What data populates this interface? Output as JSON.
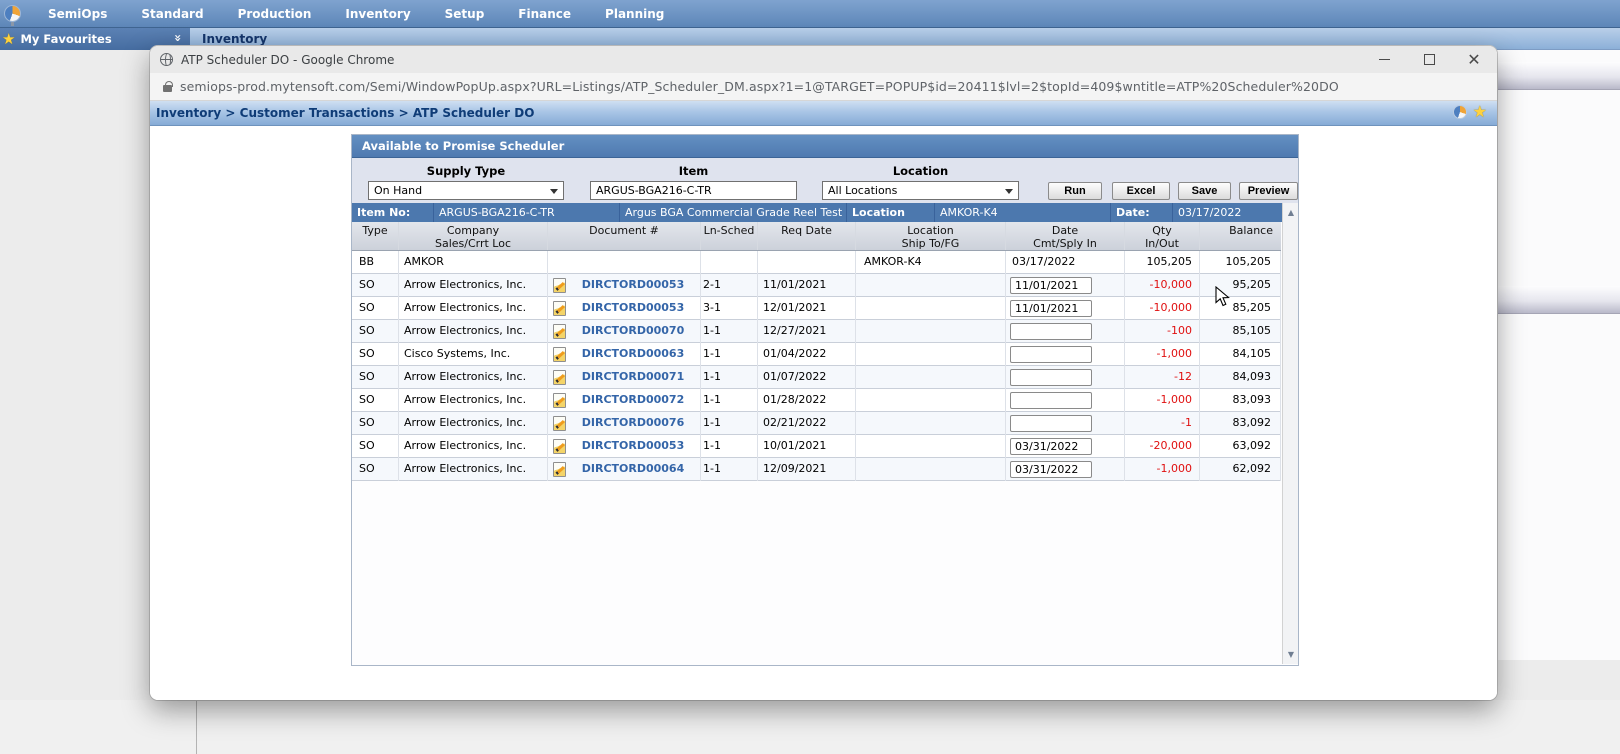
{
  "app": {
    "menu": [
      "SemiOps",
      "Standard",
      "Production",
      "Inventory",
      "Setup",
      "Finance",
      "Planning"
    ],
    "favourites_label": "My Favourites",
    "active_tab": "Inventory"
  },
  "window": {
    "title": "ATP Scheduler DO - Google Chrome",
    "url": "semiops-prod.mytensoft.com/Semi/WindowPopUp.aspx?URL=Listings/ATP_Scheduler_DM.aspx?1=1@TARGET=POPUP$id=20411$lvl=2$topId=409$wntitle=ATP%20Scheduler%20DO",
    "breadcrumb": "Inventory > Customer Transactions > ATP Scheduler DO"
  },
  "scheduler": {
    "panel_title": "Available to Promise Scheduler",
    "filters": {
      "supply_type_label": "Supply Type",
      "supply_type_value": "On Hand",
      "item_label": "Item",
      "item_value": "ARGUS-BGA216-C-TR",
      "location_label": "Location",
      "location_value": "All Locations"
    },
    "buttons": {
      "run": "Run",
      "excel": "Excel",
      "save": "Save",
      "preview": "Preview"
    },
    "info_bar": {
      "item_no_label": "Item No:",
      "item_no": "ARGUS-BGA216-C-TR",
      "item_desc": "Argus BGA Commercial Grade Reel Test",
      "location_label": "Location",
      "location_value": "AMKOR-K4",
      "date_label": "Date:",
      "date_value": "03/17/2022"
    },
    "columns": [
      {
        "line1": "Type",
        "line2": ""
      },
      {
        "line1": "Company",
        "line2": "Sales/Crrt Loc"
      },
      {
        "line1": "Document #",
        "line2": ""
      },
      {
        "line1": "Ln-Sched",
        "line2": ""
      },
      {
        "line1": "Req Date",
        "line2": ""
      },
      {
        "line1": "Location",
        "line2": "Ship To/FG"
      },
      {
        "line1": "Date",
        "line2": "Cmt/Sply In"
      },
      {
        "line1": "Qty",
        "line2": "In/Out"
      },
      {
        "line1": "Balance",
        "line2": ""
      }
    ],
    "rows": [
      {
        "type": "BB",
        "company": "AMKOR",
        "doc": "",
        "ln_sched": "",
        "req_date": "",
        "location": "AMKOR-K4",
        "date_text": "03/17/2022",
        "date_input": null,
        "qty": "105,205",
        "balance": "105,205"
      },
      {
        "type": "SO",
        "company": "Arrow Electronics, Inc.",
        "doc": "DIRCTORD00053",
        "ln_sched": "2-1",
        "req_date": "11/01/2021",
        "location": "",
        "date_text": "",
        "date_input": "11/01/2021",
        "qty": "-10,000",
        "balance": "95,205"
      },
      {
        "type": "SO",
        "company": "Arrow Electronics, Inc.",
        "doc": "DIRCTORD00053",
        "ln_sched": "3-1",
        "req_date": "12/01/2021",
        "location": "",
        "date_text": "",
        "date_input": "11/01/2021",
        "qty": "-10,000",
        "balance": "85,205"
      },
      {
        "type": "SO",
        "company": "Arrow Electronics, Inc.",
        "doc": "DIRCTORD00070",
        "ln_sched": "1-1",
        "req_date": "12/27/2021",
        "location": "",
        "date_text": "",
        "date_input": "",
        "qty": "-100",
        "balance": "85,105"
      },
      {
        "type": "SO",
        "company": "Cisco Systems, Inc.",
        "doc": "DIRCTORD00063",
        "ln_sched": "1-1",
        "req_date": "01/04/2022",
        "location": "",
        "date_text": "",
        "date_input": "",
        "qty": "-1,000",
        "balance": "84,105"
      },
      {
        "type": "SO",
        "company": "Arrow Electronics, Inc.",
        "doc": "DIRCTORD00071",
        "ln_sched": "1-1",
        "req_date": "01/07/2022",
        "location": "",
        "date_text": "",
        "date_input": "",
        "qty": "-12",
        "balance": "84,093"
      },
      {
        "type": "SO",
        "company": "Arrow Electronics, Inc.",
        "doc": "DIRCTORD00072",
        "ln_sched": "1-1",
        "req_date": "01/28/2022",
        "location": "",
        "date_text": "",
        "date_input": "",
        "qty": "-1,000",
        "balance": "83,093"
      },
      {
        "type": "SO",
        "company": "Arrow Electronics, Inc.",
        "doc": "DIRCTORD00076",
        "ln_sched": "1-1",
        "req_date": "02/21/2022",
        "location": "",
        "date_text": "",
        "date_input": "",
        "qty": "-1",
        "balance": "83,092"
      },
      {
        "type": "SO",
        "company": "Arrow Electronics, Inc.",
        "doc": "DIRCTORD00053",
        "ln_sched": "1-1",
        "req_date": "10/01/2021",
        "location": "",
        "date_text": "",
        "date_input": "03/31/2022",
        "qty": "-20,000",
        "balance": "63,092"
      },
      {
        "type": "SO",
        "company": "Arrow Electronics, Inc.",
        "doc": "DIRCTORD00064",
        "ln_sched": "1-1",
        "req_date": "12/09/2021",
        "location": "",
        "date_text": "",
        "date_input": "03/31/2022",
        "qty": "-1,000",
        "balance": "62,092"
      }
    ]
  },
  "colors": {
    "menu_blue": "#5d86b8",
    "panel_header_blue": "#5b86ba",
    "info_bar_blue": "#4c78ae",
    "negative_red": "#e01010",
    "link_blue": "#3465a8",
    "favourite_star_yellow": "#ffd23e"
  }
}
